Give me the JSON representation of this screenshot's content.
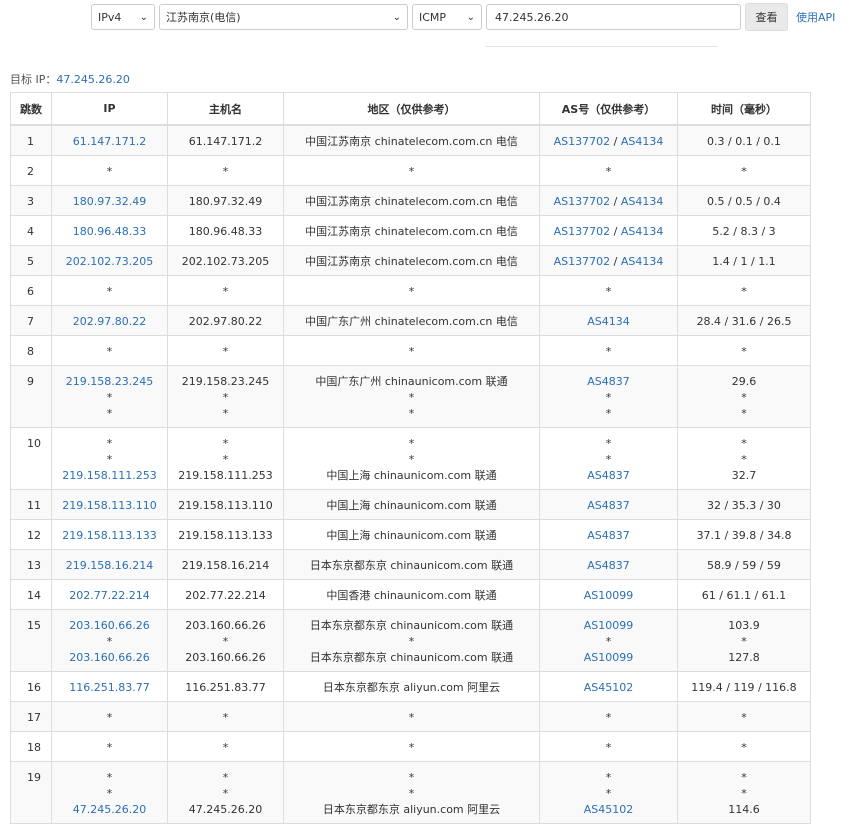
{
  "toolbar": {
    "ip_version": "IPv4",
    "location": "江苏南京(电信)",
    "protocol": "ICMP",
    "target_input": "47.245.26.20",
    "view_button": "查看",
    "api_link": "使用API"
  },
  "target": {
    "label": "目标 IP：",
    "value": "47.245.26.20"
  },
  "headers": [
    "跳数",
    "IP",
    "主机名",
    "地区（仅供参考）",
    "AS号（仅供参考）",
    "时间（毫秒）"
  ],
  "colors": {
    "link": "#2a6fb5",
    "stripe": "#f9f9f9",
    "border": "#dddddd"
  },
  "rows": [
    {
      "hop": "1",
      "lines": [
        {
          "ip": "61.147.171.2",
          "host": "61.147.171.2",
          "region": "中国江苏南京 chinatelecom.com.cn 电信",
          "as": [
            "AS137702",
            "AS4134"
          ],
          "time": "0.3 / 0.1 / 0.1"
        }
      ]
    },
    {
      "hop": "2",
      "lines": [
        {
          "ip": "*",
          "host": "*",
          "region": "*",
          "as": [
            "*"
          ],
          "time": "*"
        }
      ]
    },
    {
      "hop": "3",
      "lines": [
        {
          "ip": "180.97.32.49",
          "host": "180.97.32.49",
          "region": "中国江苏南京 chinatelecom.com.cn 电信",
          "as": [
            "AS137702",
            "AS4134"
          ],
          "time": "0.5 / 0.5 / 0.4"
        }
      ]
    },
    {
      "hop": "4",
      "lines": [
        {
          "ip": "180.96.48.33",
          "host": "180.96.48.33",
          "region": "中国江苏南京 chinatelecom.com.cn 电信",
          "as": [
            "AS137702",
            "AS4134"
          ],
          "time": "5.2 / 8.3 / 3"
        }
      ]
    },
    {
      "hop": "5",
      "lines": [
        {
          "ip": "202.102.73.205",
          "host": "202.102.73.205",
          "region": "中国江苏南京 chinatelecom.com.cn 电信",
          "as": [
            "AS137702",
            "AS4134"
          ],
          "time": "1.4 / 1 / 1.1"
        }
      ]
    },
    {
      "hop": "6",
      "lines": [
        {
          "ip": "*",
          "host": "*",
          "region": "*",
          "as": [
            "*"
          ],
          "time": "*"
        }
      ]
    },
    {
      "hop": "7",
      "lines": [
        {
          "ip": "202.97.80.22",
          "host": "202.97.80.22",
          "region": "中国广东广州 chinatelecom.com.cn 电信",
          "as": [
            "AS4134"
          ],
          "time": "28.4 / 31.6 / 26.5"
        }
      ]
    },
    {
      "hop": "8",
      "lines": [
        {
          "ip": "*",
          "host": "*",
          "region": "*",
          "as": [
            "*"
          ],
          "time": "*"
        }
      ]
    },
    {
      "hop": "9",
      "lines": [
        {
          "ip": "219.158.23.245",
          "host": "219.158.23.245",
          "region": "中国广东广州 chinaunicom.com 联通",
          "as": [
            "AS4837"
          ],
          "time": "29.6"
        },
        {
          "ip": "*",
          "host": "*",
          "region": "*",
          "as": [
            "*"
          ],
          "time": "*"
        },
        {
          "ip": "*",
          "host": "*",
          "region": "*",
          "as": [
            "*"
          ],
          "time": "*"
        }
      ]
    },
    {
      "hop": "10",
      "lines": [
        {
          "ip": "*",
          "host": "*",
          "region": "*",
          "as": [
            "*"
          ],
          "time": "*"
        },
        {
          "ip": "*",
          "host": "*",
          "region": "*",
          "as": [
            "*"
          ],
          "time": "*"
        },
        {
          "ip": "219.158.111.253",
          "host": "219.158.111.253",
          "region": "中国上海 chinaunicom.com 联通",
          "as": [
            "AS4837"
          ],
          "time": "32.7"
        }
      ]
    },
    {
      "hop": "11",
      "lines": [
        {
          "ip": "219.158.113.110",
          "host": "219.158.113.110",
          "region": "中国上海 chinaunicom.com 联通",
          "as": [
            "AS4837"
          ],
          "time": "32 / 35.3 / 30"
        }
      ]
    },
    {
      "hop": "12",
      "lines": [
        {
          "ip": "219.158.113.133",
          "host": "219.158.113.133",
          "region": "中国上海 chinaunicom.com 联通",
          "as": [
            "AS4837"
          ],
          "time": "37.1 / 39.8 / 34.8"
        }
      ]
    },
    {
      "hop": "13",
      "lines": [
        {
          "ip": "219.158.16.214",
          "host": "219.158.16.214",
          "region": "日本东京都东京 chinaunicom.com 联通",
          "as": [
            "AS4837"
          ],
          "time": "58.9 / 59 / 59"
        }
      ]
    },
    {
      "hop": "14",
      "lines": [
        {
          "ip": "202.77.22.214",
          "host": "202.77.22.214",
          "region": "中国香港 chinaunicom.com 联通",
          "as": [
            "AS10099"
          ],
          "time": "61 / 61.1 / 61.1"
        }
      ]
    },
    {
      "hop": "15",
      "lines": [
        {
          "ip": "203.160.66.26",
          "host": "203.160.66.26",
          "region": "日本东京都东京 chinaunicom.com 联通",
          "as": [
            "AS10099"
          ],
          "time": "103.9"
        },
        {
          "ip": "*",
          "host": "*",
          "region": "*",
          "as": [
            "*"
          ],
          "time": "*"
        },
        {
          "ip": "203.160.66.26",
          "host": "203.160.66.26",
          "region": "日本东京都东京 chinaunicom.com 联通",
          "as": [
            "AS10099"
          ],
          "time": "127.8"
        }
      ]
    },
    {
      "hop": "16",
      "lines": [
        {
          "ip": "116.251.83.77",
          "host": "116.251.83.77",
          "region": "日本东京都东京 aliyun.com 阿里云",
          "as": [
            "AS45102"
          ],
          "time": "119.4 / 119 / 116.8"
        }
      ]
    },
    {
      "hop": "17",
      "lines": [
        {
          "ip": "*",
          "host": "*",
          "region": "*",
          "as": [
            "*"
          ],
          "time": "*"
        }
      ]
    },
    {
      "hop": "18",
      "lines": [
        {
          "ip": "*",
          "host": "*",
          "region": "*",
          "as": [
            "*"
          ],
          "time": "*"
        }
      ]
    },
    {
      "hop": "19",
      "lines": [
        {
          "ip": "*",
          "host": "*",
          "region": "*",
          "as": [
            "*"
          ],
          "time": "*"
        },
        {
          "ip": "*",
          "host": "*",
          "region": "*",
          "as": [
            "*"
          ],
          "time": "*"
        },
        {
          "ip": "47.245.26.20",
          "host": "47.245.26.20",
          "region": "日本东京都东京 aliyun.com 阿里云",
          "as": [
            "AS45102"
          ],
          "time": "114.6"
        }
      ]
    }
  ]
}
